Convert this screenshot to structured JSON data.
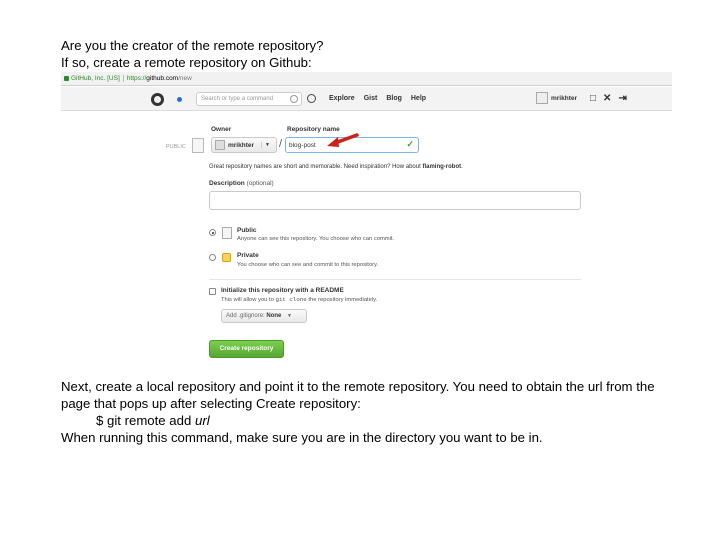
{
  "intro": {
    "line1": "Are you the creator of the remote repository?",
    "line2": "If so, create a remote repository on Github:"
  },
  "browser": {
    "secure_label": "GitHub, Inc. [US]",
    "url_scheme": "https://",
    "url_host": "github.com",
    "url_path": "/new"
  },
  "github_header": {
    "search_placeholder": "Search or type a command",
    "nav": [
      "Explore",
      "Gist",
      "Blog",
      "Help"
    ],
    "username": "mrikhter"
  },
  "form": {
    "visibility_tag": "PUBLIC",
    "owner_label": "Owner",
    "owner_value": "mrikhter",
    "repo_label": "Repository name",
    "repo_value": "blog-post",
    "hint_text": "Great repository names are short and memorable. Need inspiration? How about",
    "hint_suggestion": "flaming-robot",
    "description_label": "Description",
    "description_optional": "(optional)",
    "public_title": "Public",
    "public_desc": "Anyone can see this repository. You choose who can commit.",
    "private_title": "Private",
    "private_desc": "You choose who can see and commit to this repository.",
    "init_title": "Initialize this repository with a README",
    "init_desc_prefix": "This will allow you to",
    "init_desc_code": "git clone",
    "init_desc_suffix": "the repository immediately.",
    "gitignore_label": "Add .gitignore:",
    "gitignore_value": "None",
    "create_button": "Create repository"
  },
  "outro": {
    "line1": "Next, create a local repository and point it to the remote repository. You need to obtain the url from the page that pops up after selecting Create repository:",
    "command_prefix": "$ git remote add",
    "command_arg": "url",
    "line3": "When running this command, make sure you are in the directory you want to be in."
  },
  "colors": {
    "create_button": "#55a634",
    "arrow": "#d0201a",
    "check": "#3aa53a"
  }
}
